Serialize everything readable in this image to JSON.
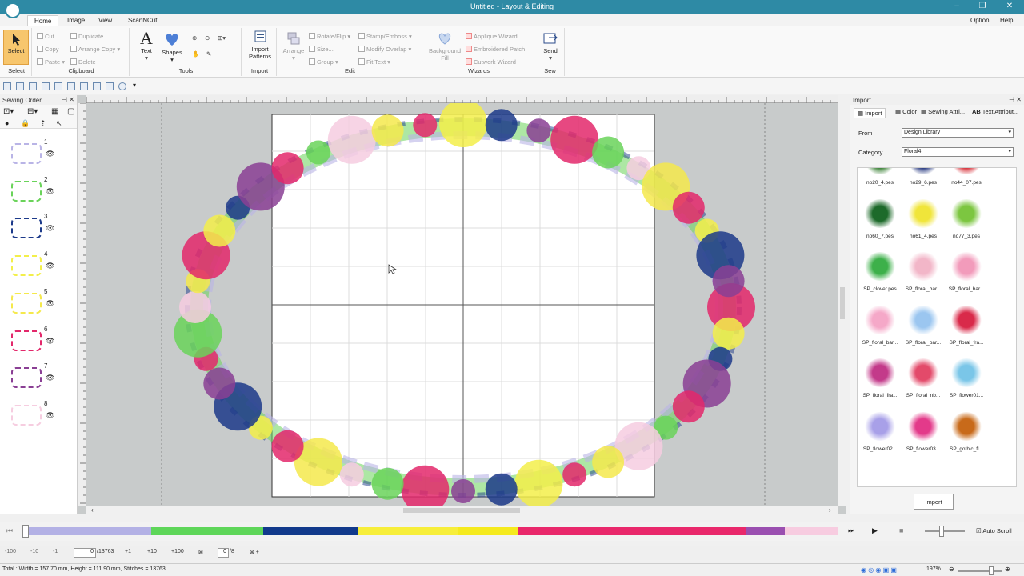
{
  "window": {
    "title": "Untitled - Layout & Editing"
  },
  "menu": {
    "tabs": [
      "Home",
      "Image",
      "View",
      "ScanNCut"
    ],
    "option": "Option",
    "help": "Help"
  },
  "ribbon": {
    "select": {
      "label": "Select",
      "group": "Select"
    },
    "clipboard": {
      "cut": "Cut",
      "copy": "Copy",
      "paste": "Paste",
      "duplicate": "Duplicate",
      "arrange_copy": "Arrange Copy",
      "delete": "Delete",
      "group": "Clipboard"
    },
    "tools": {
      "text": "Text",
      "shapes": "Shapes",
      "group": "Tools"
    },
    "import": {
      "import_patterns_line1": "Import",
      "import_patterns_line2": "Patterns",
      "group": "Import"
    },
    "edit": {
      "arrange": "Arrange",
      "rotate_flip": "Rotate/Flip",
      "size": "Size...",
      "group_btn": "Group",
      "stamp_emboss": "Stamp/Emboss",
      "modify_overlap": "Modify Overlap",
      "fit_text": "Fit Text",
      "group": "Edit"
    },
    "wizards": {
      "background_fill_line1": "Background",
      "background_fill_line2": "Fill",
      "applique": "Applique Wizard",
      "embroidered_patch": "Embroidered Patch",
      "cutwork": "Cutwork Wizard",
      "group": "Wizards"
    },
    "sew": {
      "send": "Send",
      "group": "Sew"
    }
  },
  "sewing_order": {
    "title": "Sewing Order",
    "items": [
      {
        "num": "1",
        "color": "#b9b4e6"
      },
      {
        "num": "2",
        "color": "#6ad35a"
      },
      {
        "num": "3",
        "color": "#1c3a8a"
      },
      {
        "num": "4",
        "color": "#f3ef4a"
      },
      {
        "num": "5",
        "color": "#f5e94c"
      },
      {
        "num": "6",
        "color": "#e3286b"
      },
      {
        "num": "7",
        "color": "#8a3f94"
      },
      {
        "num": "8",
        "color": "#f6cde0"
      }
    ]
  },
  "import_panel": {
    "title": "Import",
    "tabs": [
      "Import",
      "Color",
      "Sewing Attri...",
      "Text Attribut..."
    ],
    "from_label": "From",
    "from_value": "Design Library",
    "category_label": "Category",
    "category_value": "Floral4",
    "thumbnails": [
      {
        "name": "no20_4.pes",
        "color": "#2f7a2a"
      },
      {
        "name": "no29_6.pes",
        "color": "#1c2f7a"
      },
      {
        "name": "no44_07.pes",
        "color": "#d4242d"
      },
      {
        "name": "no60_7.pes",
        "color": "#1d6a2a"
      },
      {
        "name": "no61_4.pes",
        "color": "#f0e53a"
      },
      {
        "name": "no77_3.pes",
        "color": "#7cc640"
      },
      {
        "name": "SP_clover.pes",
        "color": "#3db04a"
      },
      {
        "name": "SP_floral_bar...",
        "color": "#f2b6c8"
      },
      {
        "name": "SP_floral_bar...",
        "color": "#f29bbb"
      },
      {
        "name": "SP_floral_bar...",
        "color": "#f5a8c8"
      },
      {
        "name": "SP_floral_bar...",
        "color": "#9bc6f0"
      },
      {
        "name": "SP_floral_fra...",
        "color": "#d92a4a"
      },
      {
        "name": "SP_floral_fra...",
        "color": "#c33a8a"
      },
      {
        "name": "SP_floral_nb...",
        "color": "#e34a6a"
      },
      {
        "name": "SP_flower01...",
        "color": "#7ac6e8"
      },
      {
        "name": "SP_flower02...",
        "color": "#a8a0e8"
      },
      {
        "name": "SP_flower03...",
        "color": "#e33a8a"
      },
      {
        "name": "SP_gothic_fl...",
        "color": "#c86a1a"
      }
    ],
    "import_button": "Import"
  },
  "timeline": {
    "segments": [
      {
        "color": "#b3b1e5",
        "weight": 1.55
      },
      {
        "color": "#5ed659",
        "weight": 1.4
      },
      {
        "color": "#123a8c",
        "weight": 1.18
      },
      {
        "color": "#f7ee3a",
        "weight": 1.25
      },
      {
        "color": "#f5ea1e",
        "weight": 0.75
      },
      {
        "color": "#e9286b",
        "weight": 2.85
      },
      {
        "color": "#9a4fb0",
        "weight": 0.48
      },
      {
        "color": "#f7cce0",
        "weight": 0.67
      }
    ],
    "auto_scroll": "Auto Scroll"
  },
  "step_bar": {
    "m100": "-100",
    "m10": "-10",
    "m1": "-1",
    "stitch_value": "0",
    "stitch_total": "/13763",
    "p1": "+1",
    "p10": "+10",
    "p100": "+100",
    "color_value": "0",
    "color_total": "/8"
  },
  "status": {
    "text": "Total : Width = 157.70 mm, Height = 111.90 mm, Stitches = 13763",
    "zoom": "197%"
  }
}
